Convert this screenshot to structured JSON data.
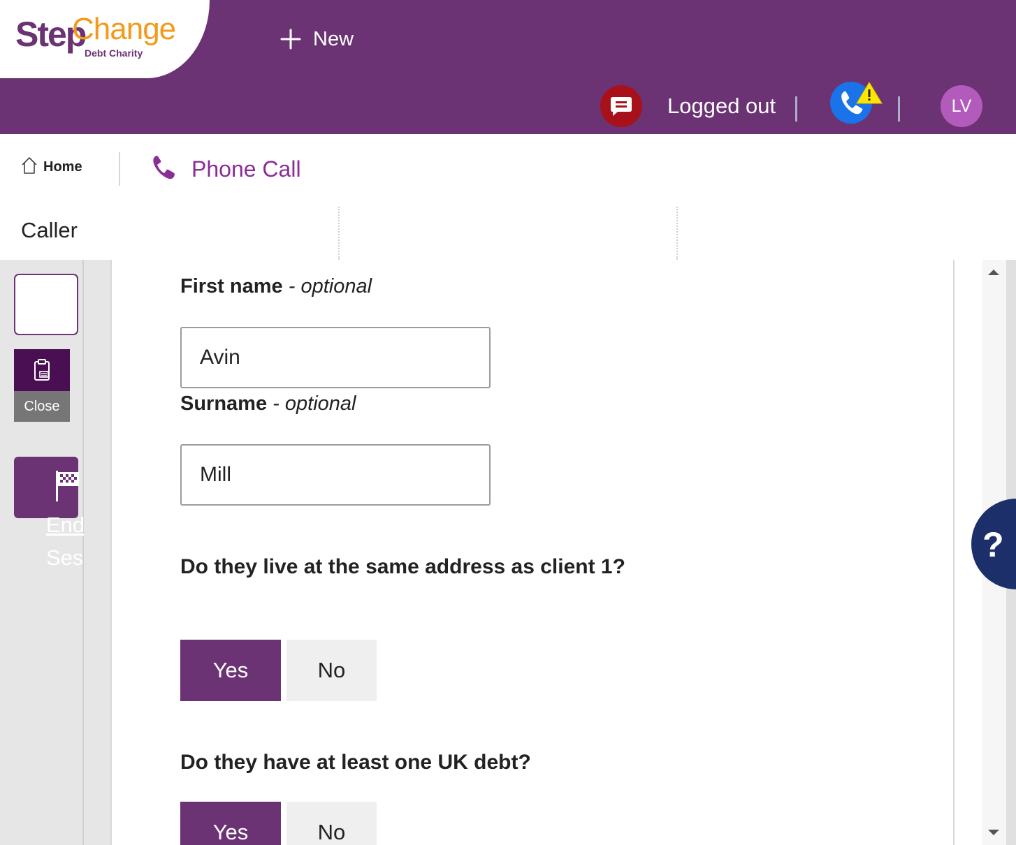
{
  "header": {
    "logo": {
      "word1": "Step",
      "word2": "Change",
      "subtitle": "Debt Charity"
    },
    "new_label": "New",
    "status_text": "Logged out",
    "avatar_initials": "LV"
  },
  "breadcrumb": {
    "home_label": "Home",
    "active_tab_label": "Phone Call"
  },
  "section": {
    "title": "Caller"
  },
  "rail": {
    "close_label": "Close",
    "end_session_line1": "End",
    "end_session_line2": "Session"
  },
  "form": {
    "first_name": {
      "label": "First name",
      "suffix": " - optional",
      "value": "Avin"
    },
    "surname": {
      "label": "Surname",
      "suffix": " - optional",
      "value": "Mill"
    },
    "q_same_address": {
      "text": "Do they live at the same address as client 1?",
      "yes": "Yes",
      "no": "No",
      "selected": "Yes"
    },
    "q_uk_debt": {
      "text": "Do they have at least one UK debt?",
      "yes": "Yes",
      "no": "No",
      "selected": "Yes"
    }
  },
  "help": {
    "label": "?"
  },
  "colors": {
    "brand_purple": "#6b3373",
    "logo_orange": "#f39a1c",
    "chat_red": "#a8101a",
    "phone_blue": "#1a73e8",
    "warning_yellow": "#ffe600",
    "avatar_purple": "#b25bbd",
    "help_navy": "#1c2f6b"
  },
  "icons": {
    "new": "plus-icon",
    "chat": "chat-icon",
    "phone_status": "phone-warning-icon",
    "home": "home-icon",
    "phone_tab": "phone-icon",
    "close": "clipboard-icon",
    "end_session": "checkered-flag-icon",
    "help": "question-icon"
  }
}
